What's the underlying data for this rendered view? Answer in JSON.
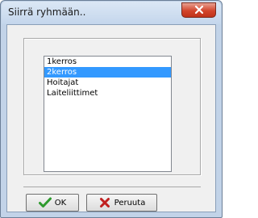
{
  "window": {
    "title": "Siirrä ryhmään.."
  },
  "list": {
    "items": [
      {
        "label": "1kerros",
        "selected": false
      },
      {
        "label": "2kerros",
        "selected": true
      },
      {
        "label": "Hoitajat",
        "selected": false
      },
      {
        "label": "Laiteliittimet",
        "selected": false
      }
    ]
  },
  "buttons": {
    "ok_label": "OK",
    "cancel_label": "Peruuta"
  },
  "colors": {
    "selection": "#3399ff",
    "ok_icon": "#2e9a2e",
    "cancel_icon": "#c02020",
    "close_button": "#d2452c"
  },
  "icons": {
    "ok": "checkmark-icon",
    "cancel": "x-icon",
    "close": "close-icon"
  }
}
